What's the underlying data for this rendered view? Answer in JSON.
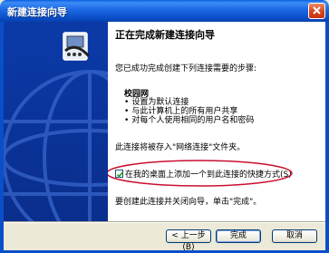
{
  "window": {
    "title": "新建连接向导"
  },
  "heading": "正在完成新建连接向导",
  "intro": "您已成功完成创建下列连接需要的步骤:",
  "connection": {
    "name": "校园网",
    "bullets": [
      "设置为默认连接",
      "与此计算机上的所有用户共享",
      "对每个人使用相同的用户名和密码"
    ]
  },
  "save_note": "此连接将被存入\"网络连接\"文件夹。",
  "shortcut_checkbox": {
    "label": "在我的桌面上添加一个到此连接的快捷方式(S)",
    "checked": true
  },
  "close_note": "要创建此连接并关闭向导，单击\"完成\"。",
  "buttons": {
    "back": "< 上一步(B)",
    "finish": "完成",
    "cancel": "取消"
  },
  "colors": {
    "titlebar": "#0a4fc8",
    "banner": "#0b3aa8",
    "face": "#ece9d8",
    "highlight_oval": "#c8102e"
  },
  "icons": {
    "close": "close-icon",
    "wizard": "network-phone-icon"
  }
}
